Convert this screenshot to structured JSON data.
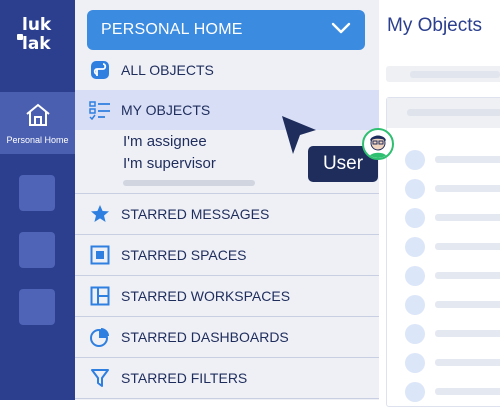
{
  "rail": {
    "logo_line1": "luk",
    "logo_line2": "lak",
    "active_item_label": "Personal Home"
  },
  "panel": {
    "dropdown_label": "PERSONAL HOME",
    "items": [
      {
        "label": "ALL OBJECTS",
        "icon": "objects-icon"
      },
      {
        "label": "MY OBJECTS",
        "icon": "list-icon"
      },
      {
        "label": "STARRED MESSAGES",
        "icon": "star-icon"
      },
      {
        "label": "STARRED SPACES",
        "icon": "space-icon"
      },
      {
        "label": "STARRED WORKSPACES",
        "icon": "workspace-icon"
      },
      {
        "label": "STARRED DASHBOARDS",
        "icon": "dashboard-icon"
      },
      {
        "label": "STARRED FILTERS",
        "icon": "filter-icon"
      }
    ],
    "sub_items": [
      "I'm assignee",
      "I'm supervisor"
    ]
  },
  "content": {
    "title": "My Objects"
  },
  "overlay": {
    "user_label": "User"
  },
  "colors": {
    "rail": "#2b3f8e",
    "accent": "#3b8be0",
    "selected": "#d7def6",
    "avatar_ring": "#2fbf71"
  }
}
